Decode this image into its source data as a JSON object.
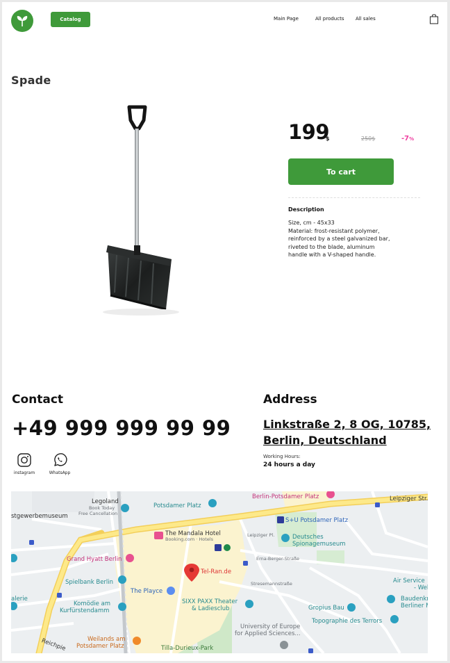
{
  "header": {
    "catalog_label": "Catalog",
    "nav": [
      "Main Page",
      "All products",
      "All sales"
    ],
    "icons": {
      "logo": "leaf-logo",
      "cart": "shopping-bag-icon"
    }
  },
  "product": {
    "title": "Spade",
    "price": "199",
    "currency": "$",
    "old_price": "250$",
    "discount": "-7",
    "discount_unit": "%",
    "cart_label": "To cart",
    "description_title": "Description",
    "description_lines": [
      "Size, cm - 45x33",
      "Material: frost-resistant polymer,",
      "reinforced by a steel galvanized bar,",
      "riveted to the blade, aluminum",
      "handle with a V-shaped handle."
    ]
  },
  "contact": {
    "heading": "Contact",
    "phone": "+49 999 999 99 99",
    "social": [
      {
        "label": "instagram",
        "icon": "instagram-icon"
      },
      {
        "label": "WhatsApp",
        "icon": "whatsapp-icon"
      }
    ]
  },
  "address": {
    "heading": "Address",
    "line1": "Linkstraße 2, 8 OG, 10785,",
    "line2": "Berlin, Deutschland",
    "hours_label": "Working Hours:",
    "hours": "24 hours a day"
  },
  "map": {
    "marker_label": "Tel-Ran.de",
    "labels": {
      "legoland": "Legoland",
      "legoland_sub1": "Book Today",
      "legoland_sub2": "Free Cancellation",
      "kunstgewerbe": "stgewerbemuseum",
      "potsdamer_platz": "Potsdamer Platz",
      "berlin_potsdamer_platz": "Berlin-Potsdamer Platz",
      "leipziger": "Leipziger Str.",
      "su_potsdamer": "S+U Potsdamer Platz",
      "mandala": "The Mandala Hotel",
      "mandala_sub": "Booking.com · Hotels",
      "leipziger_pl": "Leipziger Pl.",
      "spionage1": "Deutsches",
      "spionage2": "Spionagemuseum",
      "erna_berger": "Erna-Berger-Straße",
      "grand_hyatt": "Grand Hyatt Berlin",
      "spielbank": "Spielbank Berlin",
      "stresemann": "Stresemannstraße",
      "air_service1": "Air Service",
      "air_service2": "- Welt",
      "playce": "The Playce",
      "galerie": "alerie",
      "komodie1": "Komödie am",
      "komodie2": "Kurfürstendamm",
      "sixx1": "SIXX PAXX Theater",
      "sixx2": "& Ladiesclub",
      "gropius": "Gropius Bau",
      "baudenk1": "Baudenkm",
      "baudenk2": "Berliner M",
      "topographie": "Topographie des Terrors",
      "university1": "University of Europe",
      "university2": "for Applied Sciences...",
      "weilands1": "Weilands am",
      "weilands2": "Potsdamer Platz",
      "tilla": "Tilla-Durieux-Park",
      "reichpietsch": "Reichpie"
    }
  }
}
